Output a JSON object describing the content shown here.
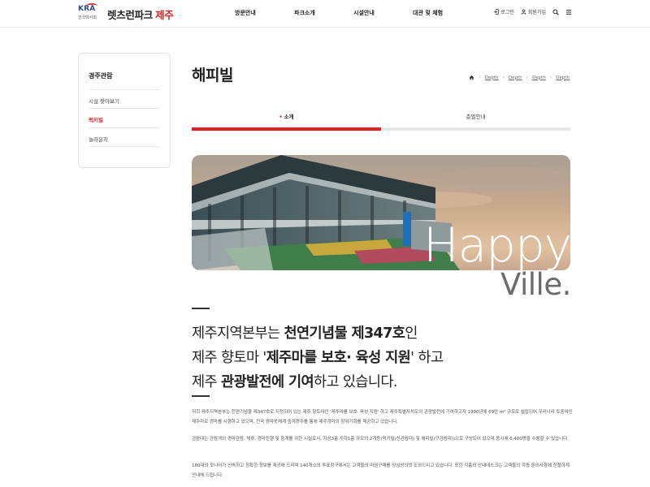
{
  "header": {
    "logo_kra": "KRA",
    "logo_sub": "한국마사회",
    "brand_main": "렛츠런파크",
    "brand_accent": "제주",
    "nav": [
      "방문안내",
      "파크소개",
      "시설안내",
      "대관 및 체험"
    ],
    "util": {
      "login": "로그인",
      "join": "회원가입"
    }
  },
  "sidebar": {
    "title": "경주관람",
    "items": [
      {
        "label": "시설 찾아보기",
        "active": false
      },
      {
        "label": "럭키빌",
        "active": true
      },
      {
        "label": "놀라운지",
        "active": false
      }
    ]
  },
  "page": {
    "title": "해피빌",
    "breadcrumb": [
      "Depth",
      "Depth",
      "Depth",
      "Depth"
    ]
  },
  "tabs": [
    {
      "label": "소개",
      "active": true
    },
    {
      "label": "층별안내",
      "active": false
    }
  ],
  "hero": {
    "word1": "Happy",
    "word2": "Ville."
  },
  "intro": {
    "line1_a": "제주지역본부는 ",
    "line1_b": "천연기념물 제347호",
    "line1_c": "인",
    "line2_a": "제주 향토마 '",
    "line2_b": "제주마를 보호· 육성 지원",
    "line2_c": "' 하고",
    "line3_a": "제주 ",
    "line3_b": "관광발전에 기여",
    "line3_c": "하고 있습니다."
  },
  "body": {
    "p1": "저희 제주지역본부는 천연기념물 제347호로 지정되어 있는 제주 향토마인 '제주마를 보호· 육성 지원' 하고 제주특별자치도의 관광발전에 기여하고자 1990년에 69만 m² 규모로 설립되어 우리나라 토종마인 제주마로 경마를 시행하고 있으며, 전국 경마동체계 중계경주를 통해 제주경마의 참여기회를 제공하고 있습니다.",
    "p2": "관람대는 관람객의 경마관람, 체류, 경마진행 및 중계를 위한 시설로서, 지상3층 지하1층 규모의 2개동(럭키빌(신관람대) 및 해피빌(구관람대))으로 구성되어 있으며 동시에 6,400명을 수용할 수 있습니다.",
    "p3": "180대의 모니터가 신속하고 정확한 정보를 제공해 드리며 140개소의 투표창구에서는 고객들의 마권구매를 성심성의껏 도와드리고 있습니다. 또한 각층의 안내데스크는 고객들의 각종 문의사항에 친절하게 안내해 드립니다."
  }
}
